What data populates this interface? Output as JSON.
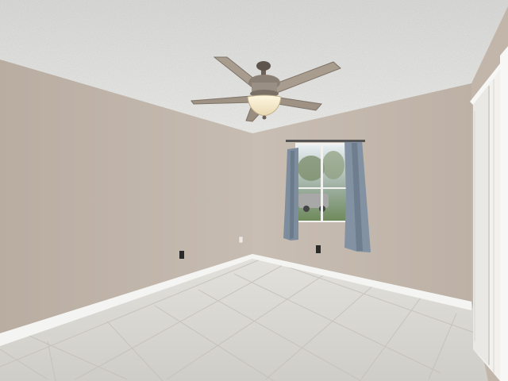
{
  "scene": {
    "description_kind": "photo",
    "subject": "empty bedroom",
    "colors": {
      "ceiling": "#e6e6e4",
      "wall_left": "#c1b6ab",
      "wall_back": "#c4b9ae",
      "floor": "#d6d4cf",
      "baseboard": "#f4f4f2",
      "curtain": "#7f8fa0",
      "closet": "#f0efec",
      "fan_blade": "#a89c8f",
      "fan_light": "#f2e8cf"
    }
  }
}
